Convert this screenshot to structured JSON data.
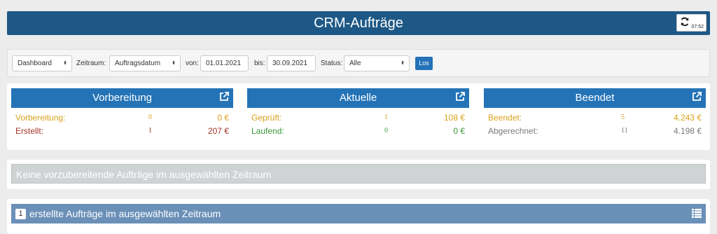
{
  "header": {
    "title": "CRM-Aufträge",
    "refresh_time": "07:52"
  },
  "filters": {
    "view_select": "Dashboard",
    "zeitraum_label": "Zeitraum:",
    "zeitraum_select": "Auftragsdatum",
    "von_label": "von:",
    "von_value": "01.01.2021",
    "bis_label": "bis:",
    "bis_value": "30.09.2021",
    "status_label": "Status:",
    "status_select": "Alle",
    "go_label": "Los"
  },
  "cards": [
    {
      "title": "Vorbereitung",
      "rows": [
        {
          "label": "Vorbereitung:",
          "count": "0",
          "amount": "0 €",
          "color": "#d9a21b"
        },
        {
          "label": "Erstellt:",
          "count": "1",
          "amount": "207 €",
          "color": "#a33327"
        }
      ]
    },
    {
      "title": "Aktuelle",
      "rows": [
        {
          "label": "Geprüft:",
          "count": "1",
          "amount": "108 €",
          "color": "#d9a21b"
        },
        {
          "label": "Laufend:",
          "count": "0",
          "amount": "0 €",
          "color": "#3a9a3a"
        }
      ]
    },
    {
      "title": "Beendet",
      "rows": [
        {
          "label": "Beendet:",
          "count": "5",
          "amount": "4.243 €",
          "color": "#d9a21b"
        },
        {
          "label": "Abgerechnet:",
          "count": "11",
          "amount": "4.198 €",
          "color": "#7a7a7a"
        }
      ]
    }
  ],
  "panels": {
    "none_prepared": "Keine vorzubereitende Aufträge im ausgewählten Zeitraum",
    "created_count": "1",
    "created_text": "erstellte Aufträge im ausgewählten Zeitraum"
  },
  "colors": {
    "header": "#1d5886",
    "card_head": "#2473b6",
    "button": "#2472b9",
    "panel_blue": "#6b90b8"
  },
  "icons": {
    "refresh": "refresh-icon",
    "external": "external-link-icon",
    "list": "list-icon"
  }
}
